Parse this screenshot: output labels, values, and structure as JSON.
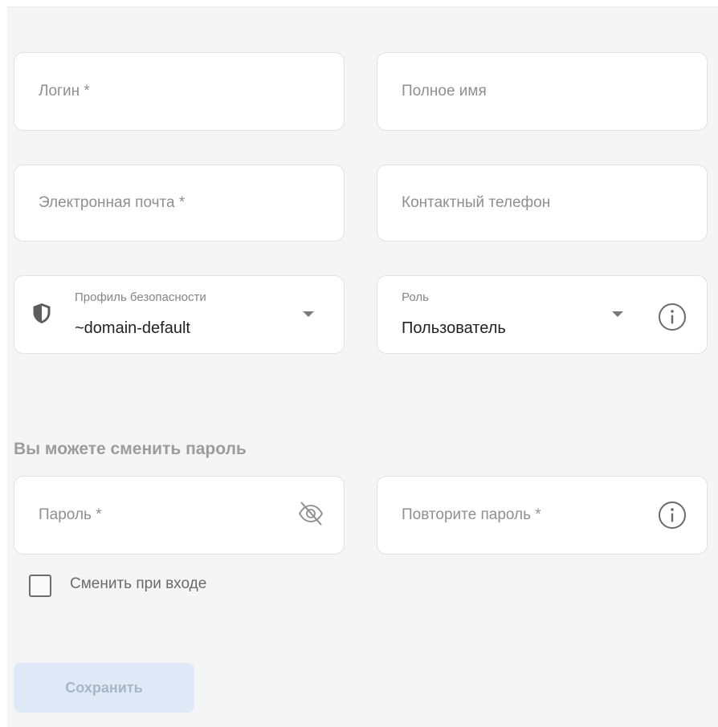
{
  "form": {
    "login": {
      "placeholder": "Логин  *"
    },
    "full_name": {
      "placeholder": "Полное имя"
    },
    "email": {
      "placeholder": "Электронная почта  *"
    },
    "phone": {
      "placeholder": "Контактный телефон"
    },
    "security_profile": {
      "label": "Профиль безопасности",
      "value": "~domain-default",
      "icon": "shield-icon"
    },
    "role": {
      "label": "Роль",
      "value": "Пользователь",
      "icon": "info-icon"
    }
  },
  "password_section": {
    "title": "Вы можете сменить пароль",
    "password": {
      "placeholder": "Пароль  *",
      "icon": "eye-off-icon"
    },
    "repeat_password": {
      "placeholder": "Повторите пароль  *",
      "icon": "info-icon"
    },
    "change_on_login": {
      "label": "Сменить при входе",
      "checked": false
    }
  },
  "actions": {
    "save_label": "Сохранить"
  },
  "colors": {
    "background": "#f5f5f5",
    "field_background": "#ffffff",
    "button_disabled_bg": "#dfe9f7",
    "button_disabled_text": "#a9b6c5"
  }
}
